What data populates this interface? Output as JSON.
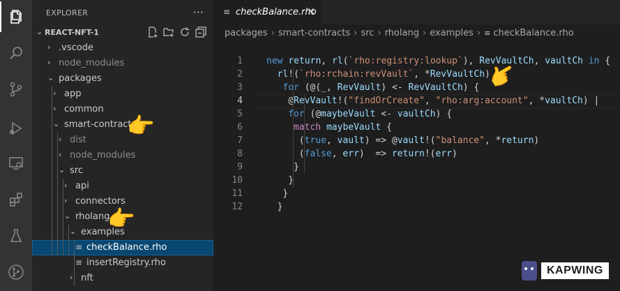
{
  "sidebar": {
    "title": "EXPLORER",
    "more": "···",
    "project": "REACT-NFT-1",
    "tree": [
      {
        "label": ".vscode",
        "arrow": "›",
        "depth": 0
      },
      {
        "label": "node_modules",
        "arrow": "›",
        "depth": 0,
        "dim": true
      },
      {
        "label": "packages",
        "arrow": "⌄",
        "depth": 0
      },
      {
        "label": "app",
        "arrow": "›",
        "depth": 1
      },
      {
        "label": "common",
        "arrow": "›",
        "depth": 1
      },
      {
        "label": "smart-contracts",
        "arrow": "⌄",
        "depth": 1
      },
      {
        "label": "dist",
        "arrow": "›",
        "depth": 2,
        "dim": true
      },
      {
        "label": "node_modules",
        "arrow": "›",
        "depth": 2,
        "dim": true
      },
      {
        "label": "src",
        "arrow": "⌄",
        "depth": 2
      },
      {
        "label": "api",
        "arrow": "›",
        "depth": 3
      },
      {
        "label": "connectors",
        "arrow": "›",
        "depth": 3
      },
      {
        "label": "rholang",
        "arrow": "⌄",
        "depth": 3
      },
      {
        "label": "examples",
        "arrow": "⌄",
        "depth": 4
      },
      {
        "label": "checkBalance.rho",
        "file": true,
        "depth": 5,
        "selected": true
      },
      {
        "label": "insertRegistry.rho",
        "file": true,
        "depth": 5
      },
      {
        "label": "nft",
        "arrow": "›",
        "depth": 4
      }
    ]
  },
  "editor": {
    "tab_name": "checkBalance.rho",
    "breadcrumb": [
      "packages",
      "smart-contracts",
      "src",
      "rholang",
      "examples",
      "checkBalance.rho"
    ],
    "line_numbers": [
      "1",
      "2",
      "3",
      "4",
      "5",
      "6",
      "7",
      "8",
      "9",
      "10",
      "11",
      "12"
    ],
    "current_line": 4
  },
  "code_lines": [
    [
      [
        "kw",
        "new "
      ],
      [
        "id",
        "return"
      ],
      [
        "plain",
        ", "
      ],
      [
        "id",
        "rl"
      ],
      [
        "plain",
        "("
      ],
      [
        "str",
        "`rho:registry:lookup`"
      ],
      [
        "plain",
        "), "
      ],
      [
        "id",
        "RevVaultCh"
      ],
      [
        "plain",
        ", "
      ],
      [
        "id",
        "vaultCh"
      ],
      [
        "kw",
        " in"
      ],
      [
        "plain",
        " {"
      ]
    ],
    [
      [
        "id",
        "rl"
      ],
      [
        "plain",
        "!("
      ],
      [
        "str",
        "`rho:rchain:revVault`"
      ],
      [
        "plain",
        ", *"
      ],
      [
        "id",
        "RevVaultCh"
      ],
      [
        "plain",
        ")"
      ]
    ],
    [
      [
        "kw",
        "for"
      ],
      [
        "plain",
        " (@("
      ],
      [
        "id",
        "_"
      ],
      [
        "plain",
        ", "
      ],
      [
        "id",
        "RevVault"
      ],
      [
        "plain",
        ") <- "
      ],
      [
        "id",
        "RevVaultCh"
      ],
      [
        "plain",
        ") {"
      ]
    ],
    [
      [
        "plain",
        "@"
      ],
      [
        "id",
        "RevVault"
      ],
      [
        "plain",
        "!("
      ],
      [
        "str",
        "\"findOrCreate\""
      ],
      [
        "plain",
        ", "
      ],
      [
        "str",
        "\"rho:arg:account\""
      ],
      [
        "plain",
        ", *"
      ],
      [
        "id",
        "vaultCh"
      ],
      [
        "plain",
        ") |"
      ]
    ],
    [
      [
        "kw",
        "for"
      ],
      [
        "plain",
        " (@"
      ],
      [
        "id",
        "maybeVault"
      ],
      [
        "plain",
        " <- "
      ],
      [
        "id",
        "vaultCh"
      ],
      [
        "plain",
        ") {"
      ]
    ],
    [
      [
        "kw2",
        "match"
      ],
      [
        "plain",
        " "
      ],
      [
        "id",
        "maybeVault"
      ],
      [
        "plain",
        " {"
      ]
    ],
    [
      [
        "plain",
        "("
      ],
      [
        "kw",
        "true"
      ],
      [
        "plain",
        ", "
      ],
      [
        "id",
        "vault"
      ],
      [
        "plain",
        ") => @"
      ],
      [
        "id",
        "vault"
      ],
      [
        "plain",
        "!("
      ],
      [
        "str",
        "\"balance\""
      ],
      [
        "plain",
        ", *"
      ],
      [
        "id",
        "return"
      ],
      [
        "plain",
        ")"
      ]
    ],
    [
      [
        "plain",
        "("
      ],
      [
        "kw",
        "false"
      ],
      [
        "plain",
        ", "
      ],
      [
        "id",
        "err"
      ],
      [
        "plain",
        ")  => "
      ],
      [
        "id",
        "return"
      ],
      [
        "plain",
        "!("
      ],
      [
        "id",
        "err"
      ],
      [
        "plain",
        ")"
      ]
    ],
    [
      [
        "plain",
        "}"
      ]
    ],
    [
      [
        "plain",
        "}"
      ]
    ],
    [
      [
        "plain",
        "}"
      ]
    ],
    [
      [
        "plain",
        "}"
      ]
    ]
  ],
  "watermark": "KAPWING",
  "hand_emoji": "👉"
}
